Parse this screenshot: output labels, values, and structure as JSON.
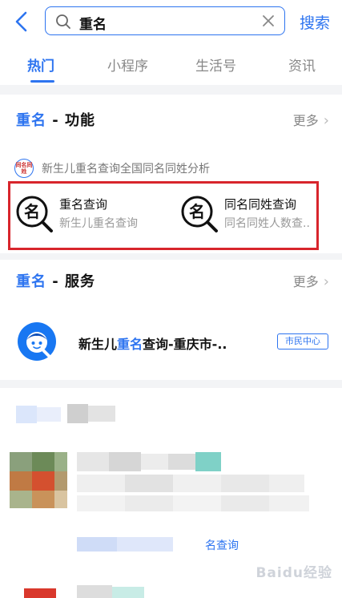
{
  "header": {
    "search_query": "重名",
    "search_button_label": "搜索"
  },
  "tabs": [
    {
      "label": "热门",
      "active": true
    },
    {
      "label": "小程序",
      "active": false
    },
    {
      "label": "生活号",
      "active": false
    },
    {
      "label": "资讯",
      "active": false
    }
  ],
  "function_section": {
    "title_highlight": "重名",
    "title_rest": " - 功能",
    "more_label": "更多",
    "badge_text": "同名同姓",
    "description": "新生儿重名查询全国同名同姓分析",
    "tools": [
      {
        "name": "重名查询",
        "subtitle": "新生儿重名查询",
        "icon": "name-search-icon"
      },
      {
        "name": "同名同姓查询",
        "subtitle": "同名同姓人数查..",
        "icon": "name-search-icon"
      }
    ]
  },
  "service_section": {
    "title_highlight": "重名",
    "title_rest": " - 服务",
    "more_label": "更多",
    "item": {
      "title_pre": "新生儿",
      "title_highlight": "重名",
      "title_post": "查询-重庆市-..",
      "tag": "市民中心"
    }
  },
  "blurred": {
    "link_fragment": "名查询"
  },
  "watermark": "Baidu经验",
  "colors": {
    "accent": "#2d74f0",
    "highlight_box": "#d8252c"
  }
}
